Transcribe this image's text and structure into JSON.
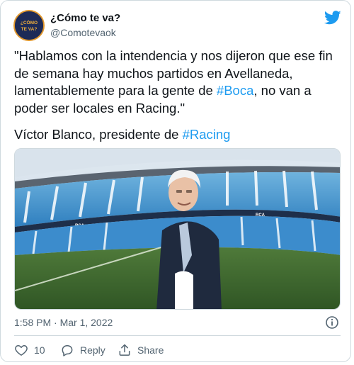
{
  "account": {
    "name": "¿Cómo te va?",
    "handle": "@Comotevaok",
    "avatar_text": "¿CÓMO TE VA?"
  },
  "tweet": {
    "line1_pre": "\"Hablamos con la intendencia y nos dijeron que ese fin de semana hay muchos partidos en Avellaneda, lamentablemente para la gente de ",
    "line1_tag": "#Boca",
    "line1_post": ", no van a poder ser locales en Racing.\"",
    "line2_pre": "Víctor Blanco, presidente de ",
    "line2_tag": "#Racing"
  },
  "photo": {
    "sign_text": "RCA"
  },
  "meta": {
    "timestamp": "1:58 PM · Mar 1, 2022"
  },
  "actions": {
    "like_count": "10",
    "reply_label": "Reply",
    "share_label": "Share"
  },
  "colors": {
    "accent": "#1d9bf0",
    "text": "#0f1419",
    "muted": "#536471",
    "border": "#cfd9de"
  },
  "icons": {
    "brand": "twitter-bird-icon",
    "info": "info-icon",
    "like": "heart-icon",
    "reply": "reply-bubble-icon",
    "share": "share-upload-icon"
  }
}
